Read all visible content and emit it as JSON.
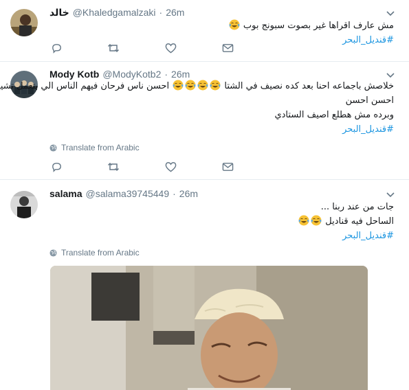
{
  "tweets": [
    {
      "name": "خالد",
      "handle": "@Khaledgamalzaki",
      "dot": "·",
      "time": "26m",
      "lines": [
        "مش عارف اقراها غير بصوت سبونج بوب",
        "#قنديل_البحر"
      ],
      "translate": ""
    },
    {
      "name": "Mody Kotb",
      "handle": "@ModyKotb2",
      "dot": "·",
      "time": "26m",
      "lines": [
        "خلاصش باجماعه احنا بعد كده نصيف في الشتا",
        "احسن ناس فرحان فيهم الناس الي بتعمل تشيك ان",
        "احسن احسن",
        "وبرده مش هطلع اصيف الستادي",
        "#قنديل_البحر"
      ],
      "translate": "Translate from Arabic"
    },
    {
      "name": "salama",
      "handle": "@salama39745449",
      "dot": "·",
      "time": "26m",
      "lines": [
        "جات من عند ربنا ...",
        "الساحل فيه قناديل",
        "#قنديل_البحر"
      ],
      "translate": "Translate from Arabic"
    }
  ],
  "icons": {
    "reply": "reply-icon",
    "retweet": "retweet-icon",
    "like": "heart-icon",
    "message": "direct-message-icon",
    "caret": "chevron-down-icon",
    "globe": "globe-icon",
    "emoji": "face-with-tears-of-joy-emoji"
  },
  "colors": {
    "link": "#1b95e0",
    "secondary": "#657786",
    "text": "#14171a",
    "divider": "#e6ecf0"
  }
}
